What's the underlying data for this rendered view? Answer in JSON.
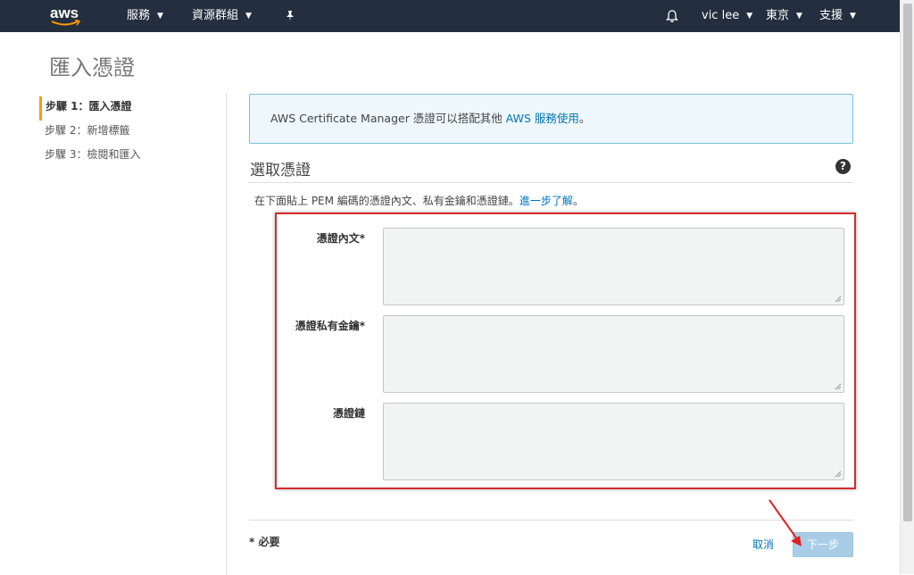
{
  "nav": {
    "logo": "aws",
    "services": "服務",
    "resource_groups": "資源群組",
    "user": "vic lee",
    "region": "東京",
    "support": "支援"
  },
  "page": {
    "title": "匯入憑證"
  },
  "steps": [
    {
      "label": "步驟 1：匯入憑證",
      "active": true
    },
    {
      "label": "步驟 2：新增標籤",
      "active": false
    },
    {
      "label": "步驟 3：檢閱和匯入",
      "active": false
    }
  ],
  "info": {
    "text": "AWS Certificate Manager 憑證可以搭配其他 ",
    "link": "AWS 服務使用",
    "suffix": "。"
  },
  "section": {
    "title": "選取憑證",
    "description": "在下面貼上 PEM 編碼的憑證內文、私有金鑰和憑證鏈。",
    "learn_more": "進一步了解",
    "learn_more_suffix": "。"
  },
  "fields": {
    "body_label": "憑證內文*",
    "key_label": "憑證私有金鑰*",
    "chain_label": "憑證鏈"
  },
  "footer": {
    "required_note": "* 必要",
    "cancel": "取消",
    "next": "下一步"
  },
  "colors": {
    "nav_bg": "#232f3e",
    "link": "#0073bb",
    "highlight_box": "#d52b2b",
    "active_step": "#ff9900"
  }
}
